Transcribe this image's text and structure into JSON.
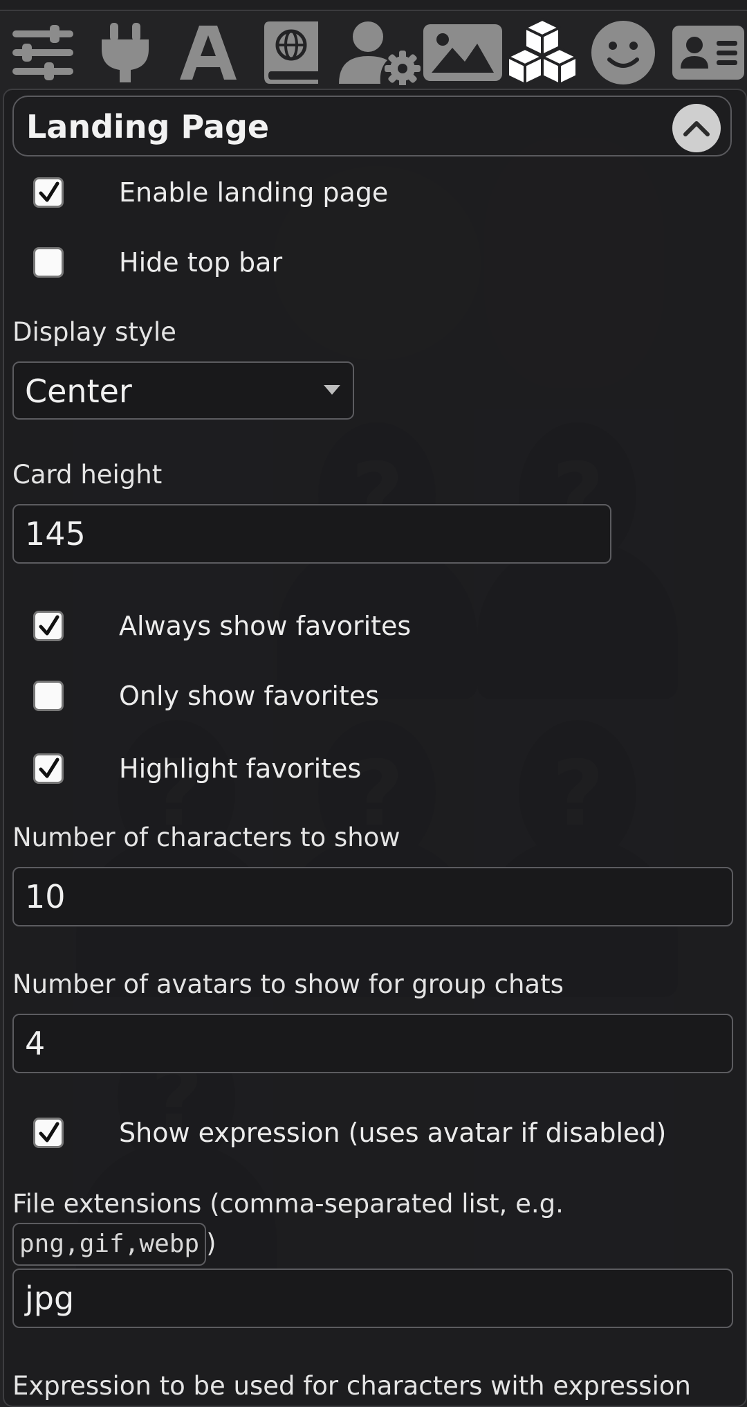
{
  "toolbar": {
    "icons": [
      {
        "name": "sliders-icon"
      },
      {
        "name": "plug-icon"
      },
      {
        "name": "font-icon"
      },
      {
        "name": "book-atlas-icon"
      },
      {
        "name": "user-gear-icon"
      },
      {
        "name": "image-icon"
      },
      {
        "name": "cubes-icon",
        "active": true
      },
      {
        "name": "smile-icon"
      },
      {
        "name": "address-card-icon"
      }
    ]
  },
  "panel": {
    "title": "Landing Page",
    "collapse_icon": "chevron-up-icon"
  },
  "settings": {
    "enable_landing_page": {
      "label": "Enable landing page",
      "checked": true
    },
    "hide_top_bar": {
      "label": "Hide top bar",
      "checked": false
    },
    "display_style": {
      "label": "Display style",
      "value": "Center"
    },
    "card_height": {
      "label": "Card height",
      "value": "145"
    },
    "always_show_favorites": {
      "label": "Always show favorites",
      "checked": true
    },
    "only_show_favorites": {
      "label": "Only show favorites",
      "checked": false
    },
    "highlight_favorites": {
      "label": "Highlight favorites",
      "checked": true
    },
    "num_characters": {
      "label": "Number of characters to show",
      "value": "10"
    },
    "num_avatars": {
      "label": "Number of avatars to show for group chats",
      "value": "4"
    },
    "show_expression": {
      "label": "Show expression (uses avatar if disabled)",
      "checked": true
    },
    "file_extensions": {
      "label_before": "File extensions (comma-separated list, e.g.",
      "example": "png,gif,webp",
      "label_after": ")",
      "value": "jpg"
    },
    "expression_label": "Expression to be used for characters with expression"
  },
  "colors": {
    "background": "#232325",
    "checkbox": "#fafafa",
    "active_icon": "#ffffff",
    "inactive_icon": "#8c8c8c"
  }
}
